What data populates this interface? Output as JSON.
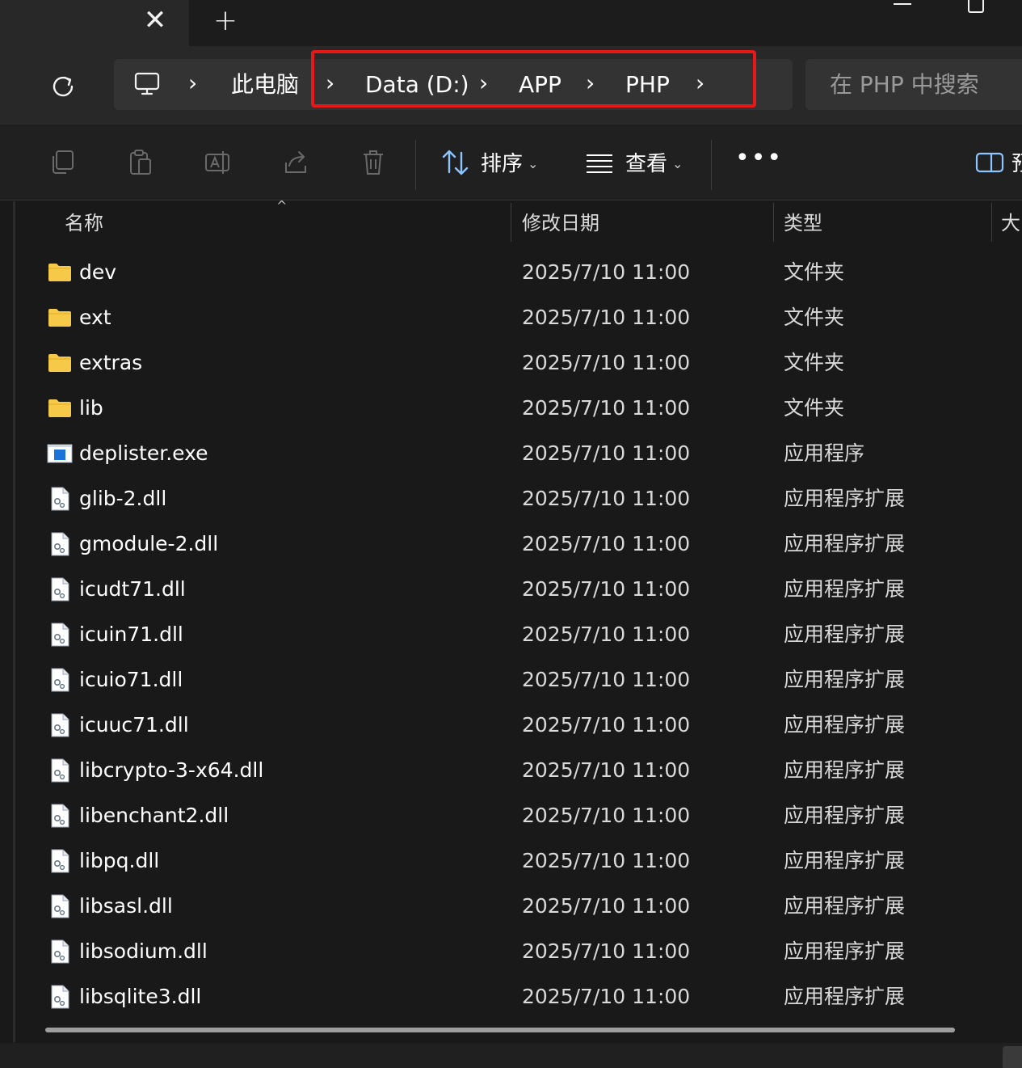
{
  "tabs": {
    "close_symbol": "✕",
    "new_tab_symbol": "+"
  },
  "breadcrumb": {
    "items": [
      "此电脑",
      "Data (D:)",
      "APP",
      "PHP"
    ],
    "separator": "›"
  },
  "search": {
    "placeholder": "在 PHP 中搜索"
  },
  "toolbar": {
    "sort_label": "排序",
    "view_label": "查看",
    "more_label": "•••",
    "truncated_label": "预"
  },
  "columns": {
    "name": "名称",
    "modified": "修改日期",
    "type": "类型",
    "size": "大"
  },
  "files": [
    {
      "name": "dev",
      "date": "2025/7/10 11:00",
      "type": "文件夹",
      "kind": "folder-icon"
    },
    {
      "name": "ext",
      "date": "2025/7/10 11:00",
      "type": "文件夹",
      "kind": "folder-icon"
    },
    {
      "name": "extras",
      "date": "2025/7/10 11:00",
      "type": "文件夹",
      "kind": "folder-icon"
    },
    {
      "name": "lib",
      "date": "2025/7/10 11:00",
      "type": "文件夹",
      "kind": "folder-icon"
    },
    {
      "name": "deplister.exe",
      "date": "2025/7/10 11:00",
      "type": "应用程序",
      "kind": "exe-icon"
    },
    {
      "name": "glib-2.dll",
      "date": "2025/7/10 11:00",
      "type": "应用程序扩展",
      "kind": "dll-icon"
    },
    {
      "name": "gmodule-2.dll",
      "date": "2025/7/10 11:00",
      "type": "应用程序扩展",
      "kind": "dll-icon"
    },
    {
      "name": "icudt71.dll",
      "date": "2025/7/10 11:00",
      "type": "应用程序扩展",
      "kind": "dll-icon"
    },
    {
      "name": "icuin71.dll",
      "date": "2025/7/10 11:00",
      "type": "应用程序扩展",
      "kind": "dll-icon"
    },
    {
      "name": "icuio71.dll",
      "date": "2025/7/10 11:00",
      "type": "应用程序扩展",
      "kind": "dll-icon"
    },
    {
      "name": "icuuc71.dll",
      "date": "2025/7/10 11:00",
      "type": "应用程序扩展",
      "kind": "dll-icon"
    },
    {
      "name": "libcrypto-3-x64.dll",
      "date": "2025/7/10 11:00",
      "type": "应用程序扩展",
      "kind": "dll-icon"
    },
    {
      "name": "libenchant2.dll",
      "date": "2025/7/10 11:00",
      "type": "应用程序扩展",
      "kind": "dll-icon"
    },
    {
      "name": "libpq.dll",
      "date": "2025/7/10 11:00",
      "type": "应用程序扩展",
      "kind": "dll-icon"
    },
    {
      "name": "libsasl.dll",
      "date": "2025/7/10 11:00",
      "type": "应用程序扩展",
      "kind": "dll-icon"
    },
    {
      "name": "libsodium.dll",
      "date": "2025/7/10 11:00",
      "type": "应用程序扩展",
      "kind": "dll-icon"
    },
    {
      "name": "libsqlite3.dll",
      "date": "2025/7/10 11:00",
      "type": "应用程序扩展",
      "kind": "dll-icon"
    }
  ],
  "colors": {
    "highlight": "#e81818",
    "folder": "#f7c948",
    "exe": "#1a73d9"
  }
}
